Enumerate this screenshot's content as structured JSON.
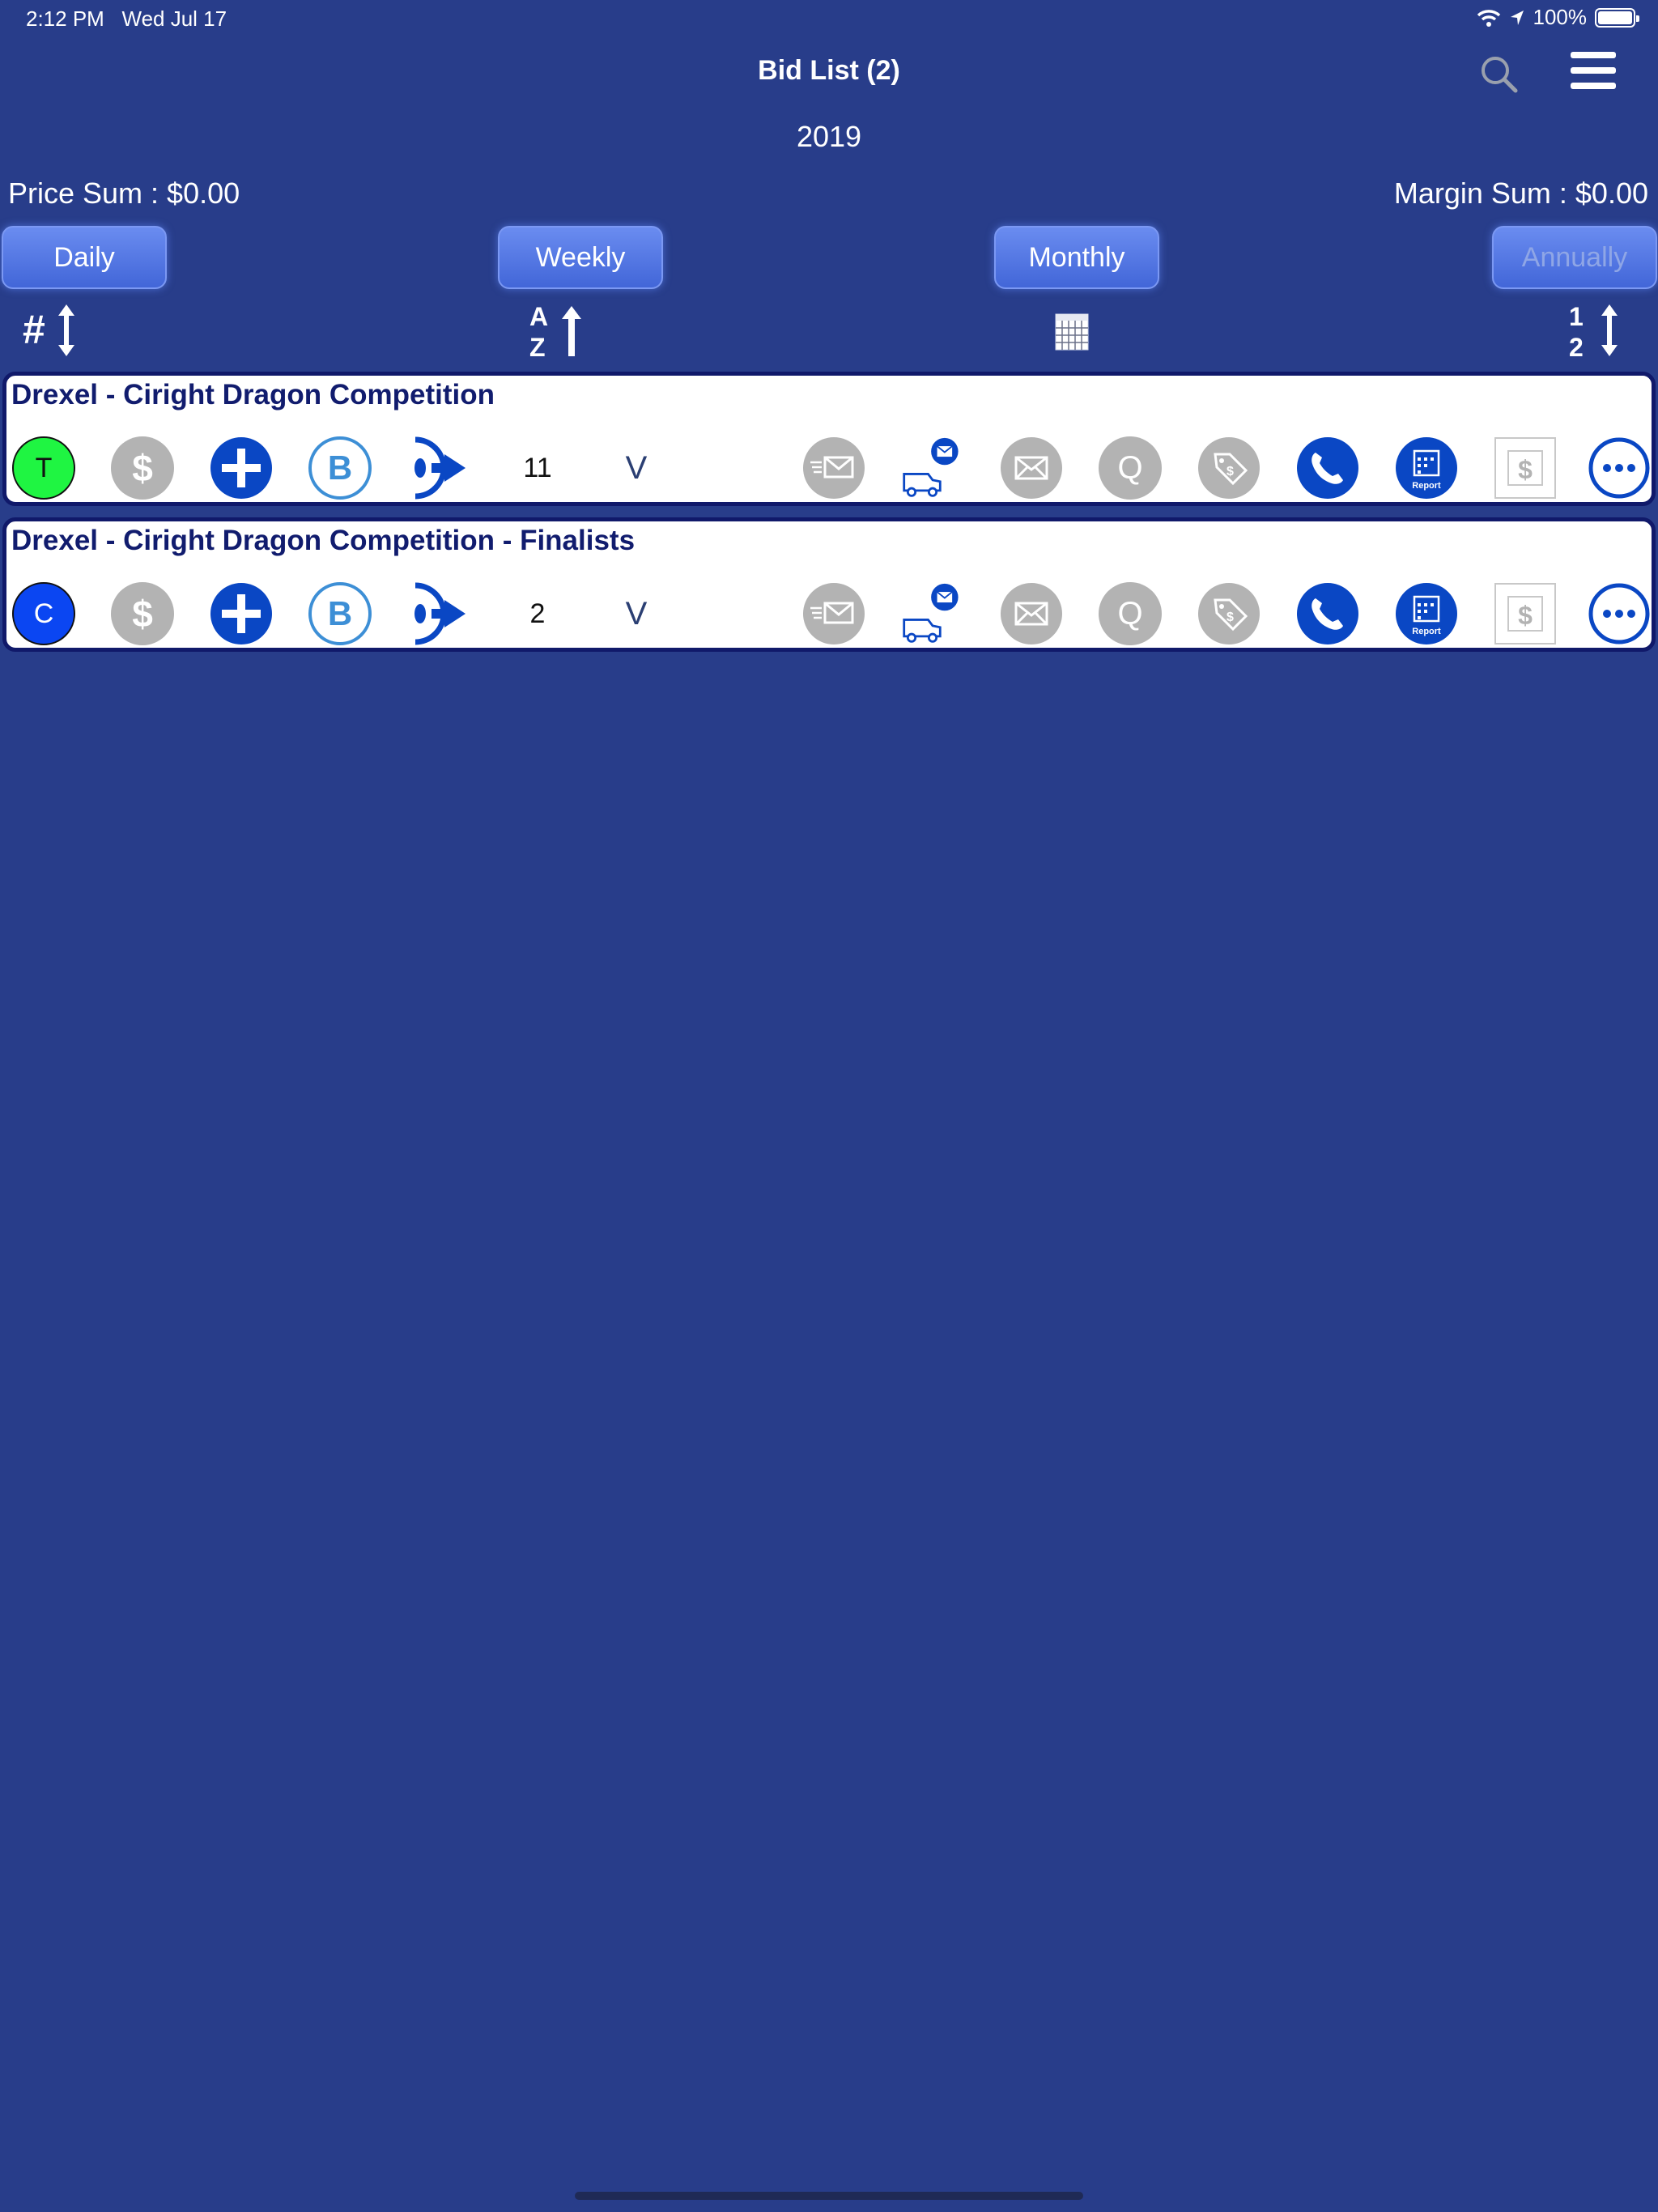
{
  "status_bar": {
    "time": "2:12 PM",
    "date": "Wed Jul 17",
    "battery": "100%",
    "battery_level": 1.0
  },
  "header": {
    "title": "Bid List (2)",
    "year": "2019",
    "search_icon": "search-icon",
    "menu_icon": "hamburger-menu-icon"
  },
  "summary": {
    "price_sum": "Price Sum : $0.00",
    "margin_sum": "Margin Sum : $0.00"
  },
  "periods": [
    {
      "label": "Daily",
      "enabled": true
    },
    {
      "label": "Weekly",
      "enabled": true
    },
    {
      "label": "Monthly",
      "enabled": true
    },
    {
      "label": "Annually",
      "enabled": false
    }
  ],
  "sort_bar": {
    "number_sort_icon": "hash-sort-icon",
    "alpha_sort_icon": "alpha-sort-icon",
    "calendar_icon": "calendar-icon",
    "numeric_sort_icon": "numeric-sort-icon"
  },
  "bids": [
    {
      "title": "Drexel - Ciright Dragon Competition",
      "status_letter": "T",
      "status_color": "#1ff542",
      "count": "11",
      "v_label": "V"
    },
    {
      "title": "Drexel - Ciright Dragon Competition - Finalists",
      "status_letter": "C",
      "status_color": "#0b46f2",
      "count": "2",
      "v_label": "V"
    }
  ],
  "colors": {
    "background": "#283d8a",
    "card_border": "#10196a",
    "action_blue": "#0a47c4",
    "action_gray": "#b3b3b3",
    "title_text": "#111c6e"
  },
  "action_icons": [
    "dollar-icon",
    "plus-icon",
    "b-icon",
    "forward-signal-icon",
    "fax-mail-icon",
    "truck-message-icon",
    "mail-blocked-icon",
    "q-icon",
    "price-tag-icon",
    "phone-icon",
    "report-calendar-icon",
    "dollar-square-icon",
    "more-icon"
  ],
  "report_label": "Report",
  "q_label": "Q",
  "b_label": "B"
}
